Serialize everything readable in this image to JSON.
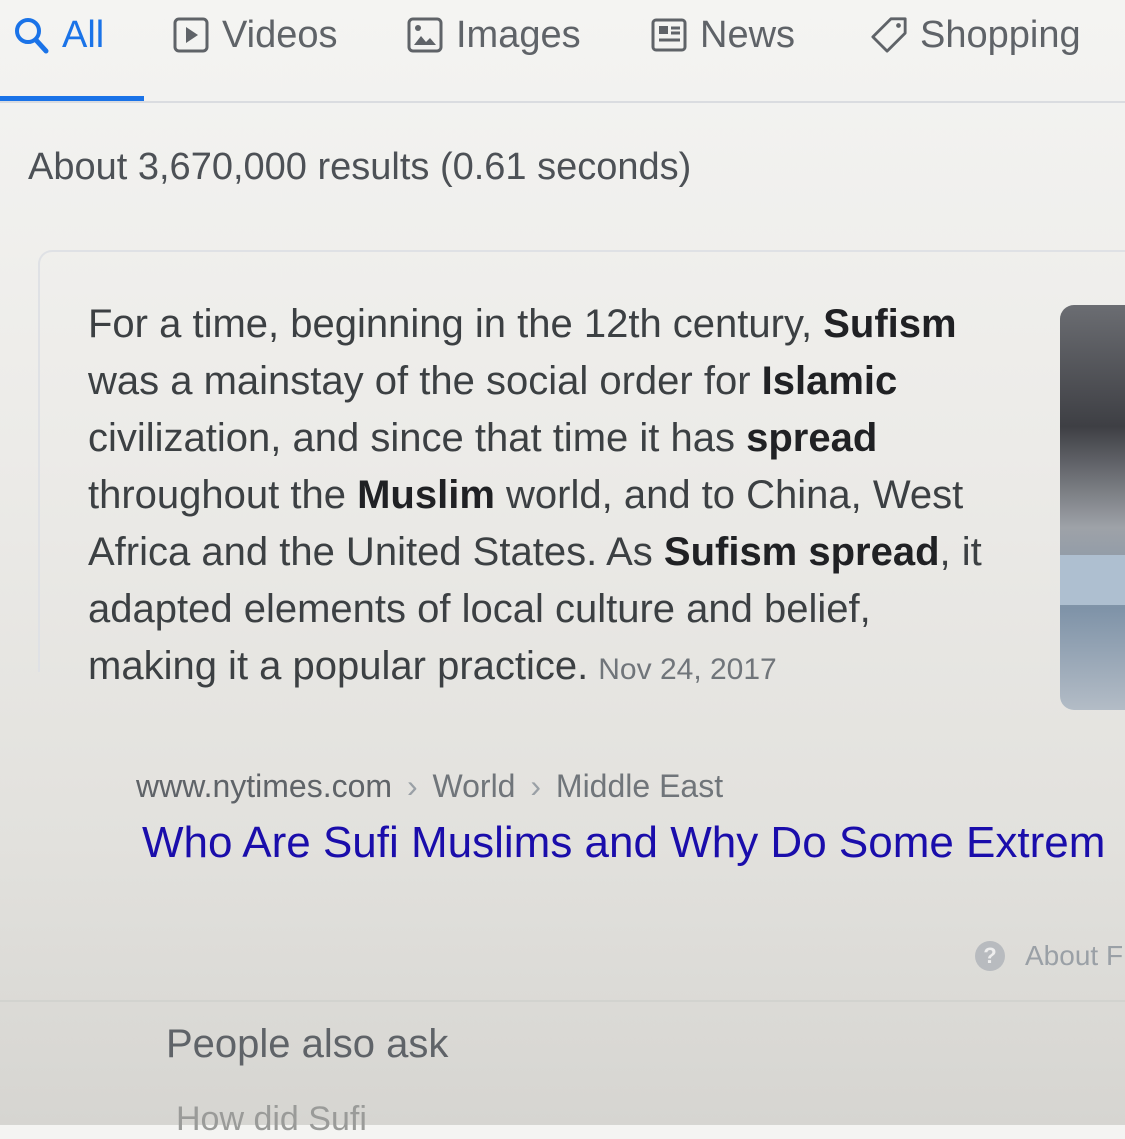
{
  "tabs": [
    {
      "label": "All",
      "icon": "search-icon",
      "active": true
    },
    {
      "label": "Videos",
      "icon": "video-play-icon",
      "active": false
    },
    {
      "label": "Images",
      "icon": "image-icon",
      "active": false
    },
    {
      "label": "News",
      "icon": "newspaper-icon",
      "active": false
    },
    {
      "label": "Shopping",
      "icon": "tag-icon",
      "active": false
    }
  ],
  "result_stats": "About 3,670,000 results (0.61 seconds)",
  "snippet": {
    "segments": [
      {
        "text": "For a time, beginning in the 12th century, "
      },
      {
        "text": "Sufism",
        "bold": true
      },
      {
        "text": " was a mainstay of the social order for "
      },
      {
        "text": "Islamic",
        "bold": true
      },
      {
        "text": " civilization, and since that time it has "
      },
      {
        "text": "spread",
        "bold": true
      },
      {
        "text": " throughout the "
      },
      {
        "text": "Muslim",
        "bold": true
      },
      {
        "text": " world, and to China, West Africa and the United States. As "
      },
      {
        "text": "Sufism spread",
        "bold": true
      },
      {
        "text": ", it adapted elements of local culture and belief, making it a popular practice."
      }
    ],
    "date": "Nov 24, 2017"
  },
  "source": {
    "domain": "www.nytimes.com",
    "path": [
      "World",
      "Middle East"
    ],
    "separator": "›"
  },
  "result_title": "Who Are Sufi Muslims and Why Do Some Extrem",
  "about_featured": "About F",
  "help_icon_glyph": "?",
  "people_also_ask": {
    "title": "People also ask",
    "first_question": "How did Sufi"
  },
  "colors": {
    "accent": "#1a73e8",
    "link": "#1a0dab",
    "text": "#3c4043"
  }
}
